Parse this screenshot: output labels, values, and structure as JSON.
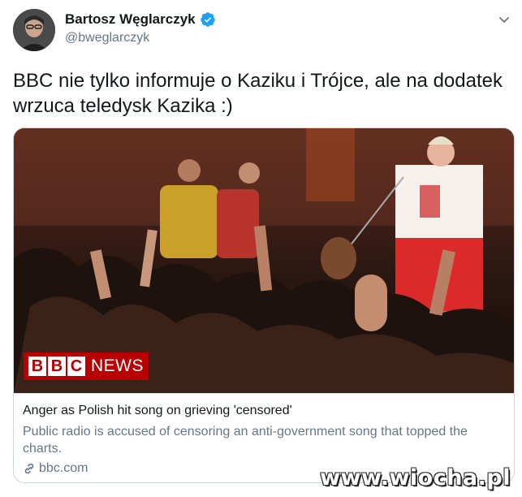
{
  "author": {
    "display_name": "Bartosz Węglarczyk",
    "handle": "@bweglarczyk",
    "verified": true
  },
  "tweet": {
    "text": "BBC nie tylko informuje o Kaziku i Trójce, ale na dodatek wrzuca teledysk Kazika :)"
  },
  "card": {
    "title": "Anger as Polish hit song on grieving 'censored'",
    "description": "Public radio is accused of censoring an anti-government song that topped the charts.",
    "domain": "bbc.com",
    "image_logo": {
      "box_letters": [
        "B",
        "B",
        "C"
      ],
      "word": "NEWS"
    }
  },
  "watermark": "www.wiocha.pl",
  "icons": {
    "verified": "verified-badge-icon",
    "menu": "chevron-down-icon",
    "link": "link-icon"
  },
  "colors": {
    "verified_blue": "#1da1f2",
    "bbc_red": "#b80000",
    "secondary_text": "#657786"
  }
}
